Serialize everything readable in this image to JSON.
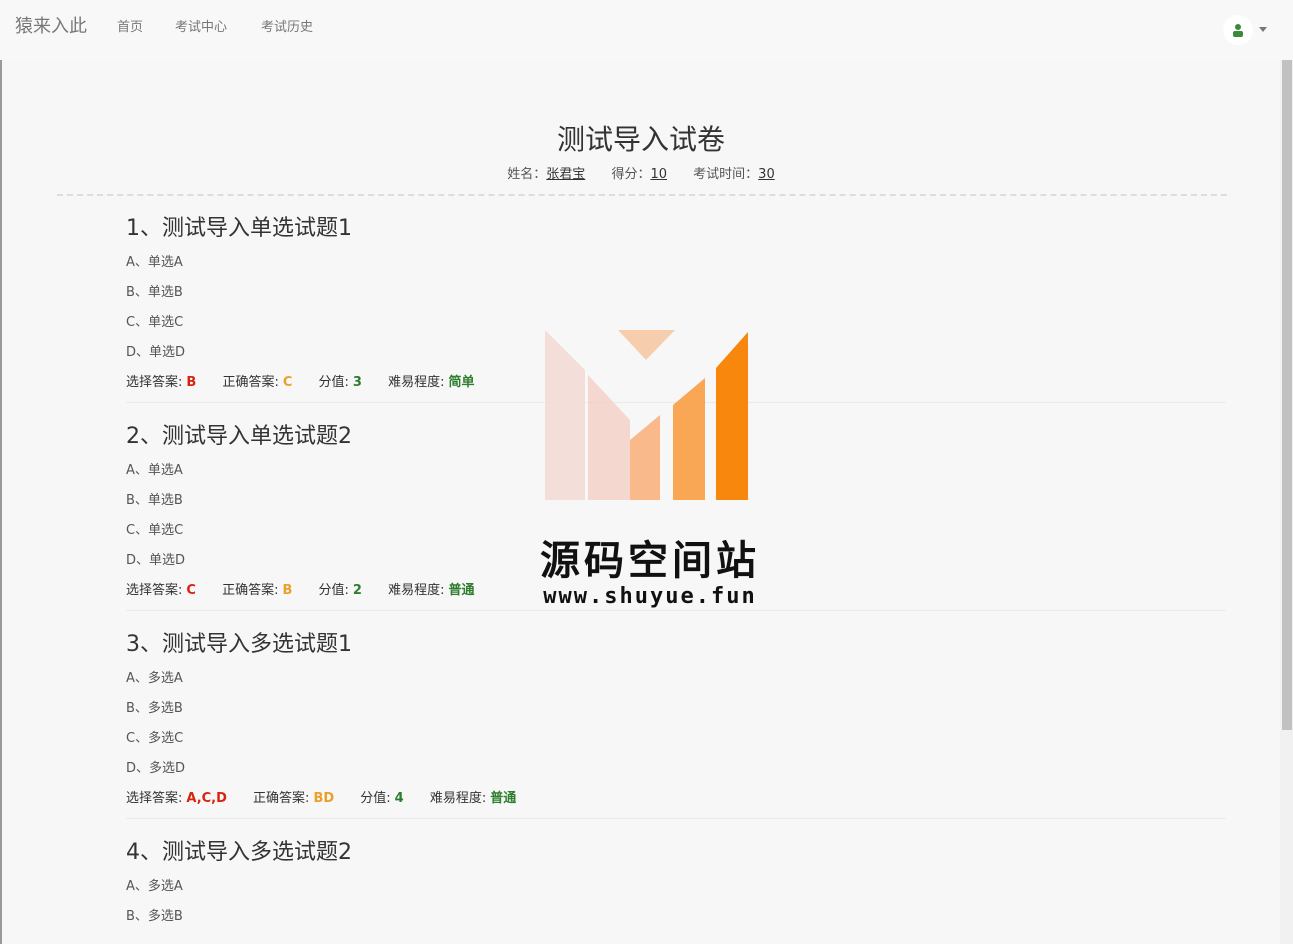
{
  "navbar": {
    "brand": "猿来入此",
    "links": [
      "首页",
      "考试中心",
      "考试历史"
    ]
  },
  "exam": {
    "title": "测试导入试卷",
    "name_label": "姓名：",
    "name_value": "张君宝",
    "score_label": "得分：",
    "score_value": "10",
    "time_label": "考试时间：",
    "time_value": "30"
  },
  "labels": {
    "selected": "选择答案:",
    "correct": "正确答案:",
    "score": "分值:",
    "difficulty": "难易程度:"
  },
  "questions": [
    {
      "title": "1、测试导入单选试题1",
      "options": [
        "A、单选A",
        "B、单选B",
        "C、单选C",
        "D、单选D"
      ],
      "selected": "B",
      "correct": "C",
      "score": "3",
      "difficulty": "简单"
    },
    {
      "title": "2、测试导入单选试题2",
      "options": [
        "A、单选A",
        "B、单选B",
        "C、单选C",
        "D、单选D"
      ],
      "selected": "C",
      "correct": "B",
      "score": "2",
      "difficulty": "普通"
    },
    {
      "title": "3、测试导入多选试题1",
      "options": [
        "A、多选A",
        "B、多选B",
        "C、多选C",
        "D、多选D"
      ],
      "selected": "A,C,D",
      "correct": "BD",
      "score": "4",
      "difficulty": "普通"
    },
    {
      "title": "4、测试导入多选试题2",
      "options": [
        "A、多选A",
        "B、多选B"
      ],
      "selected": "",
      "correct": "",
      "score": "",
      "difficulty": ""
    }
  ],
  "watermark": {
    "text": "源码空间站",
    "url": "www.shuyue.fun"
  },
  "colors": {
    "selected": "#d9230f",
    "correct": "#e9a12b",
    "score": "#2f7d2f",
    "difficulty": "#2f7d2f"
  }
}
